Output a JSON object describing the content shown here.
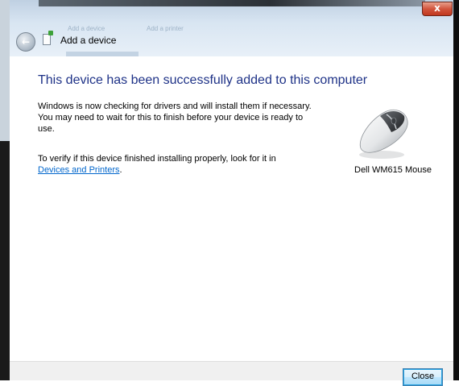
{
  "window": {
    "title": "Add a device",
    "ghost_labels": [
      "Add a device",
      "Add a printer"
    ],
    "close_glyph": "x"
  },
  "icons": {
    "back": "back-arrow-icon",
    "device": "add-device-icon",
    "close": "close-icon",
    "mouse": "mouse-device-icon"
  },
  "content": {
    "heading": "This device has been successfully added to this computer",
    "paragraph1": "Windows is now checking for drivers and will install them if necessary. You may need to wait for this to finish before your device is ready to use.",
    "paragraph2_prefix": "To verify if this device finished installing properly, look for it in",
    "link_text": "Devices and Printers",
    "paragraph2_suffix": "."
  },
  "device": {
    "name": "Dell WM615 Mouse"
  },
  "footer": {
    "close_label": "Close"
  },
  "colors": {
    "heading": "#1e3287",
    "link": "#0066cc",
    "titlebar": "#d8e5f2",
    "footer": "#f0f0f0"
  }
}
